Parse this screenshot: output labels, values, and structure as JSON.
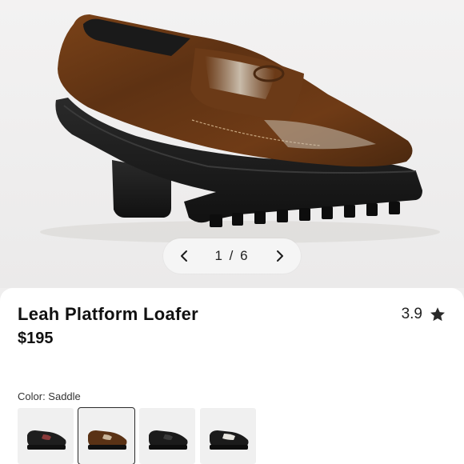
{
  "gallery": {
    "counter": "1 / 6",
    "prev_icon": "chevron-left-icon",
    "next_icon": "chevron-right-icon"
  },
  "product": {
    "name": "Leah Platform Loafer",
    "price": "$195",
    "rating": "3.9",
    "rating_icon": "star-icon"
  },
  "color": {
    "label": "Color:",
    "selected": "Saddle",
    "swatches": [
      {
        "name": "black-with-red-accent",
        "body": "#1e1e1e",
        "accent": "#8a3a3a"
      },
      {
        "name": "saddle",
        "body": "#5a3215",
        "accent": "#c9b59a"
      },
      {
        "name": "black",
        "body": "#1b1b1b",
        "accent": "#3a3a3a"
      },
      {
        "name": "black-with-chalk",
        "body": "#1b1b1b",
        "accent": "#e8e6e0"
      }
    ]
  },
  "colors": {
    "sheet_bg": "#ffffff",
    "page_bg": "#efeeee",
    "text": "#111111",
    "leather": "#6b3a17"
  }
}
